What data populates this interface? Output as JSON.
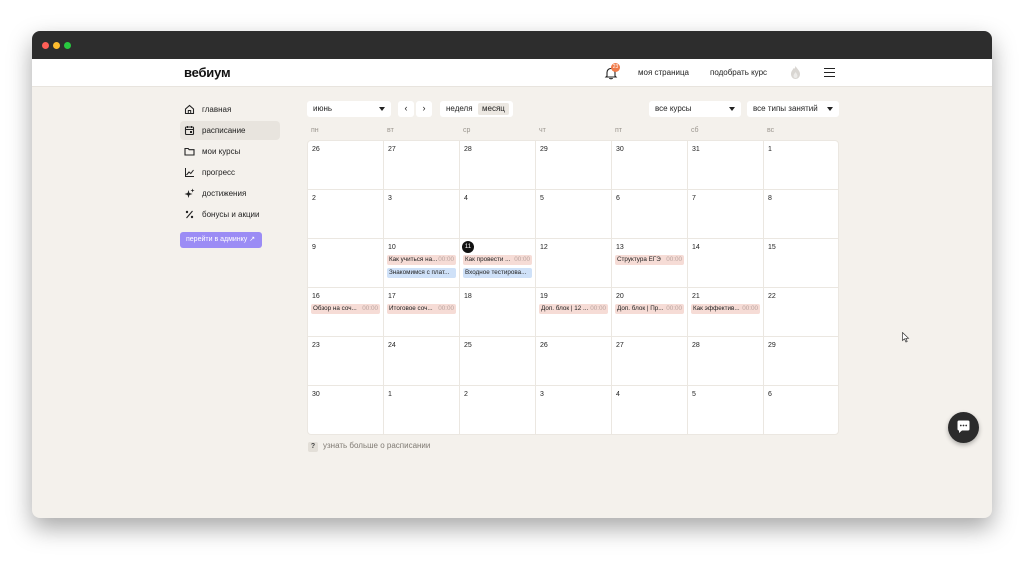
{
  "window": {
    "dots": [
      "#ff5f57",
      "#febc2e",
      "#28c840"
    ]
  },
  "header": {
    "logo": "вебиум",
    "notifications_count": "23",
    "my_page": "моя страница",
    "pick_course": "подобрать курс"
  },
  "sidebar": {
    "items": [
      {
        "label": "главная",
        "icon": "home-icon"
      },
      {
        "label": "расписание",
        "icon": "calendar-icon"
      },
      {
        "label": "мои курсы",
        "icon": "folder-icon"
      },
      {
        "label": "прогресс",
        "icon": "chart-line-icon"
      },
      {
        "label": "достижения",
        "icon": "sparkle-icon"
      },
      {
        "label": "бонусы и акции",
        "icon": "percent-icon"
      }
    ],
    "active": "расписание",
    "admin_button": "перейти в админку ↗"
  },
  "toolbar": {
    "month": "июнь",
    "view_week": "неделя",
    "view_month": "месяц",
    "selected_view": "месяц",
    "courses": "все курсы",
    "lesson_types": "все типы занятий"
  },
  "calendar": {
    "weekdays": [
      "пн",
      "вт",
      "ср",
      "чт",
      "пт",
      "сб",
      "вс"
    ],
    "weeks": [
      [
        {
          "day": "26",
          "events": []
        },
        {
          "day": "27",
          "events": []
        },
        {
          "day": "28",
          "events": []
        },
        {
          "day": "29",
          "events": []
        },
        {
          "day": "30",
          "events": []
        },
        {
          "day": "31",
          "events": []
        },
        {
          "day": "1",
          "events": []
        }
      ],
      [
        {
          "day": "2",
          "events": []
        },
        {
          "day": "3",
          "events": []
        },
        {
          "day": "4",
          "events": []
        },
        {
          "day": "5",
          "events": []
        },
        {
          "day": "6",
          "events": []
        },
        {
          "day": "7",
          "events": []
        },
        {
          "day": "8",
          "events": []
        }
      ],
      [
        {
          "day": "9",
          "events": []
        },
        {
          "day": "10",
          "events": [
            {
              "title": "Как учиться на...",
              "time": "00:00",
              "color": "red"
            },
            {
              "title": "Знакомимся с плат...",
              "time": "",
              "color": "blue"
            }
          ]
        },
        {
          "day": "11",
          "today": true,
          "events": [
            {
              "title": "Как провести ...",
              "time": "00:00",
              "color": "red"
            },
            {
              "title": "Входное тестирова...",
              "time": "",
              "color": "blue"
            }
          ]
        },
        {
          "day": "12",
          "events": []
        },
        {
          "day": "13",
          "events": [
            {
              "title": "Структура ЕГЭ",
              "time": "00:00",
              "color": "red"
            }
          ]
        },
        {
          "day": "14",
          "events": []
        },
        {
          "day": "15",
          "events": []
        }
      ],
      [
        {
          "day": "16",
          "events": [
            {
              "title": "Обзор на соч...",
              "time": "00:00",
              "color": "red"
            }
          ]
        },
        {
          "day": "17",
          "events": [
            {
              "title": "Итоговое соч...",
              "time": "00:00",
              "color": "red"
            }
          ]
        },
        {
          "day": "18",
          "events": []
        },
        {
          "day": "19",
          "events": [
            {
              "title": "Доп. блок | 12 ...",
              "time": "00:00",
              "color": "red"
            }
          ]
        },
        {
          "day": "20",
          "events": [
            {
              "title": "Доп. блок | Пр...",
              "time": "00:00",
              "color": "red"
            }
          ]
        },
        {
          "day": "21",
          "events": [
            {
              "title": "Как эффектив...",
              "time": "00:00",
              "color": "red"
            }
          ]
        },
        {
          "day": "22",
          "events": []
        }
      ],
      [
        {
          "day": "23",
          "events": []
        },
        {
          "day": "24",
          "events": []
        },
        {
          "day": "25",
          "events": []
        },
        {
          "day": "26",
          "events": []
        },
        {
          "day": "27",
          "events": []
        },
        {
          "day": "28",
          "events": []
        },
        {
          "day": "29",
          "events": []
        }
      ],
      [
        {
          "day": "30",
          "events": []
        },
        {
          "day": "1",
          "events": []
        },
        {
          "day": "2",
          "events": []
        },
        {
          "day": "3",
          "events": []
        },
        {
          "day": "4",
          "events": []
        },
        {
          "day": "5",
          "events": []
        },
        {
          "day": "6",
          "events": []
        }
      ]
    ]
  },
  "footer": {
    "help_text": "узнать больше о расписании"
  },
  "colors": {
    "accent": "#9b8cf5",
    "event_red": "#f6dcd6",
    "event_blue": "#cfe1f8",
    "badge": "#f07b4a"
  }
}
